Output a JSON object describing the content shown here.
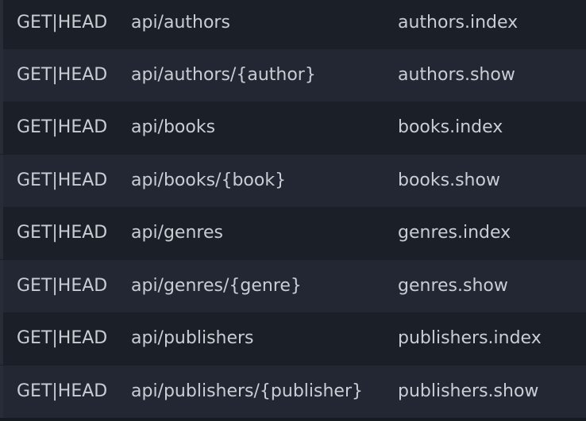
{
  "routes": [
    {
      "method": "GET|HEAD",
      "uri": "api/authors",
      "name": "authors.index"
    },
    {
      "method": "GET|HEAD",
      "uri": "api/authors/{author}",
      "name": "authors.show"
    },
    {
      "method": "GET|HEAD",
      "uri": "api/books",
      "name": "books.index"
    },
    {
      "method": "GET|HEAD",
      "uri": "api/books/{book}",
      "name": "books.show"
    },
    {
      "method": "GET|HEAD",
      "uri": "api/genres",
      "name": "genres.index"
    },
    {
      "method": "GET|HEAD",
      "uri": "api/genres/{genre}",
      "name": "genres.show"
    },
    {
      "method": "GET|HEAD",
      "uri": "api/publishers",
      "name": "publishers.index"
    },
    {
      "method": "GET|HEAD",
      "uri": "api/publishers/{publisher}",
      "name": "publishers.show"
    }
  ]
}
